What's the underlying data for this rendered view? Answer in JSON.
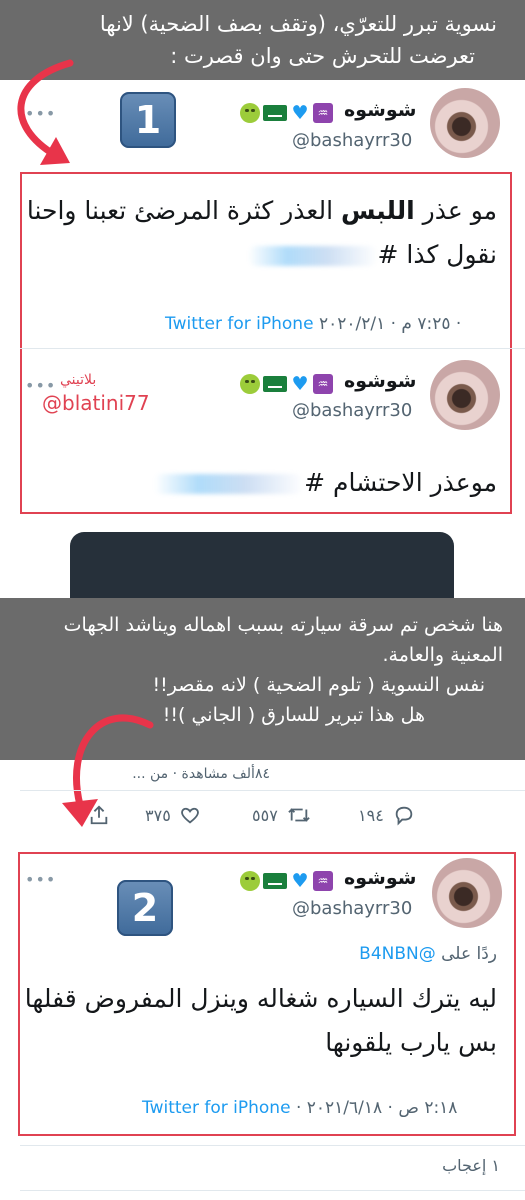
{
  "caption_top": {
    "line1": "نسوية تبرر للتعرّي، (وتقف بصف الضحية) لانها",
    "line2": "تعرضت للتحرش حتى وان قصرت  :"
  },
  "tweet1": {
    "number": "1",
    "display_name": "شوشوه",
    "handle": "@bashayrr30",
    "text_line1_part1": "مو عذر ",
    "text_line1_bold": "اللبس",
    "text_line1_part2": " العذر كثرة المرضئ تعبنا واحنا",
    "text_line2": "نقول كذا #",
    "timestamp": "٧:٢٥ م · ٢٠٢٠/٢/١",
    "source": "Twitter for iPhone"
  },
  "reply1": {
    "display_name": "شوشوه",
    "handle": "@bashayrr30",
    "text": "موعذر الاحتشام #"
  },
  "watermark": {
    "name": "بلاتيني",
    "handle": "@blatini77"
  },
  "caption_mid": {
    "line1": "هنا شخص تم سرقة سيارته بسبب اهماله ويناشد الجهات",
    "line2": "المعنية والعامة.",
    "line3": "نفس النسوية ( تلوم الضحية ) لانه مقصر!!",
    "line4": "هل هذا تبرير للسارق ( الجاني )!!"
  },
  "post_stats": {
    "views": "٨٤ألف مشاهدة · من ...",
    "replies": "١٩٤",
    "retweets": "٥٥٧",
    "likes": "٣٧٥"
  },
  "tweet2": {
    "number": "2",
    "display_name": "شوشوه",
    "handle": "@bashayrr30",
    "replying_prefix": "ردًا على",
    "replying_handle": "@B4NBN",
    "text_line1": "ليه يترك السياره شغاله وينزل المفروض قفلها",
    "text_line2": "بس يارب يلقونها",
    "timestamp": "٢:١٨ ص · ٢٠٢١/٦/١٨",
    "source": "Twitter for iPhone"
  },
  "footer": {
    "likes_label": "١ إعجاب"
  },
  "colors": {
    "caption_bg": "#6b6b6b",
    "highlight_border": "#e04252",
    "link": "#1d9bf0",
    "arrow": "#e8344a"
  },
  "icons": [
    "more-dots-icon",
    "share-icon",
    "like-heart-icon",
    "retweet-icon",
    "reply-icon",
    "down-arrow-icon"
  ]
}
